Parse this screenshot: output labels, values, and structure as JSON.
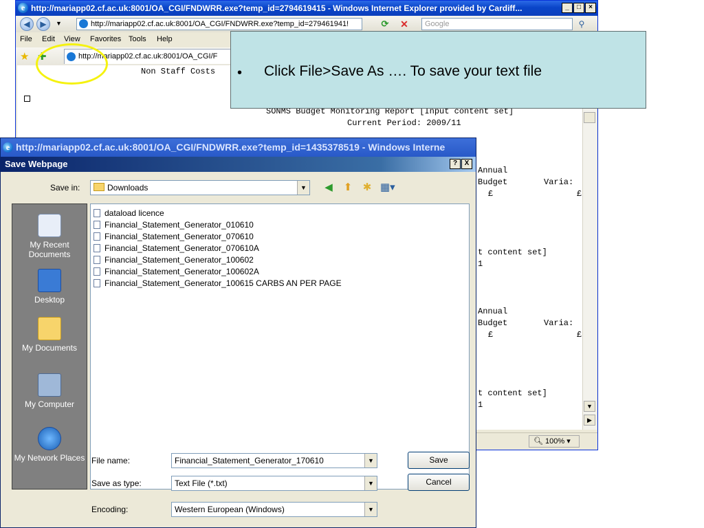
{
  "ie": {
    "title": "http://mariapp02.cf.ac.uk:8001/OA_CGI/FNDWRR.exe?temp_id=2794619415 - Windows Internet Explorer provided by Cardiff...",
    "address": "http://mariapp02.cf.ac.uk:8001/OA_CGI/FNDWRR.exe?temp_id=279461941!",
    "search_placeholder": "Google",
    "menu": [
      "File",
      "Edit",
      "View",
      "Favorites",
      "Tools",
      "Help"
    ],
    "tab_label": "http://mariapp02.cf.ac.uk:8001/OA_CGI/F",
    "zoom": "100%",
    "content": {
      "line1": "Non Staff Costs",
      "report_title": "SONMS Budget Monitoring Report [Input content set]",
      "period": "Current Period: 2009/11",
      "col_annual": "Annual",
      "col_budget": "Budget",
      "col_varia": "Varia:",
      "currency": "£",
      "content_set": "t content set]",
      "digit": "1"
    }
  },
  "second_window_title": "http://mariapp02.cf.ac.uk:8001/OA_CGI/FNDWRR.exe?temp_id=1435378519 - Windows Interne",
  "dialog": {
    "title": "Save Webpage",
    "save_in_label": "Save in:",
    "save_in_value": "Downloads",
    "places": [
      "My Recent Documents",
      "Desktop",
      "My Documents",
      "My Computer",
      "My Network Places"
    ],
    "files": [
      "dataload licence",
      "Financial_Statement_Generator_010610",
      "Financial_Statement_Generator_070610",
      "Financial_Statement_Generator_070610A",
      "Financial_Statement_Generator_100602",
      "Financial_Statement_Generator_100602A",
      "Financial_Statement_Generator_100615 CARBS AN PER PAGE"
    ],
    "file_name_label": "File name:",
    "file_name_value": "Financial_Statement_Generator_170610",
    "save_as_type_label": "Save as type:",
    "save_as_type_value": "Text File (*.txt)",
    "encoding_label": "Encoding:",
    "encoding_value": "Western European (Windows)",
    "save_button": "Save",
    "cancel_button": "Cancel",
    "help_button": "?",
    "close_button": "X"
  },
  "callout": {
    "bullet": "•",
    "text": "Click File>Save As ….  To save your text file"
  }
}
